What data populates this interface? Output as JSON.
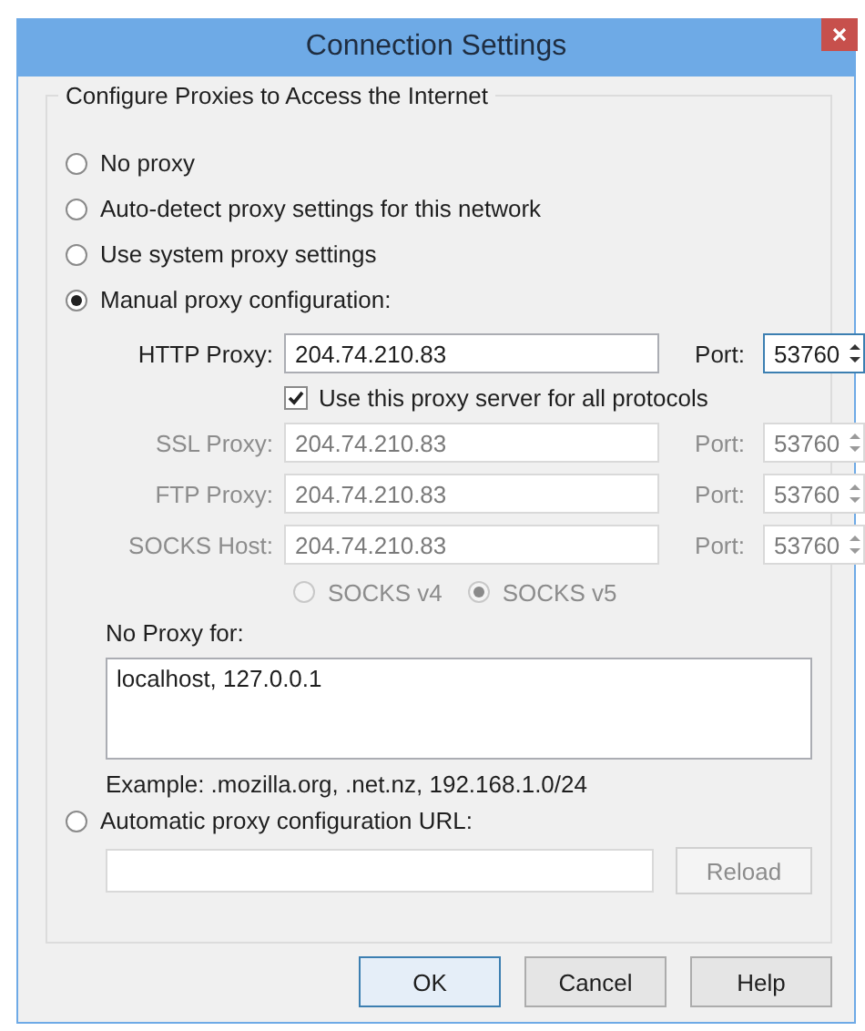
{
  "window": {
    "title": "Connection Settings"
  },
  "group": {
    "legend": "Configure Proxies to Access the Internet"
  },
  "proxy_modes": [
    {
      "label": "No proxy",
      "selected": false
    },
    {
      "label": "Auto-detect proxy settings for this network",
      "selected": false
    },
    {
      "label": "Use system proxy settings",
      "selected": false
    },
    {
      "label": "Manual proxy configuration:",
      "selected": true
    },
    {
      "label": "Automatic proxy configuration URL:",
      "selected": false
    }
  ],
  "proxies": [
    {
      "label": "HTTP Proxy:",
      "value": "204.74.210.83",
      "port_label": "Port:",
      "port": "53760",
      "disabled": false,
      "focused": true
    },
    {
      "label": "SSL Proxy:",
      "value": "204.74.210.83",
      "port_label": "Port:",
      "port": "53760",
      "disabled": true,
      "focused": false
    },
    {
      "label": "FTP Proxy:",
      "value": "204.74.210.83",
      "port_label": "Port:",
      "port": "53760",
      "disabled": true,
      "focused": false
    },
    {
      "label": "SOCKS Host:",
      "value": "204.74.210.83",
      "port_label": "Port:",
      "port": "53760",
      "disabled": true,
      "focused": false
    }
  ],
  "share_all": {
    "label": "Use this proxy server for all protocols",
    "checked": true
  },
  "socks_versions": [
    {
      "label": "SOCKS v4",
      "selected": false,
      "disabled": true
    },
    {
      "label": "SOCKS v5",
      "selected": true,
      "disabled": true
    }
  ],
  "no_proxy": {
    "label": "No Proxy for:",
    "value": "localhost, 127.0.0.1"
  },
  "example": "Example: .mozilla.org, .net.nz, 192.168.1.0/24",
  "reload_button": {
    "label": "Reload",
    "disabled": true
  },
  "buttons": [
    {
      "label": "OK",
      "default": true
    },
    {
      "label": "Cancel",
      "default": false
    },
    {
      "label": "Help",
      "default": false
    }
  ]
}
